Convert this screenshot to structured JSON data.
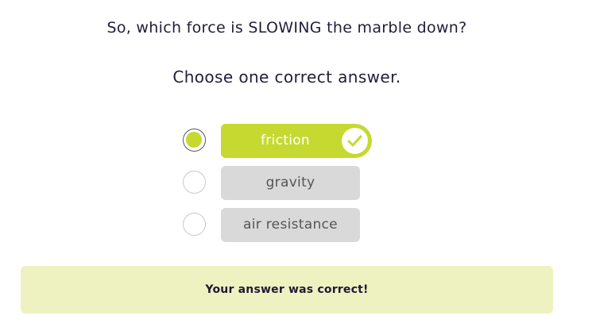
{
  "question": {
    "text": "So, which force is SLOWING the marble down?",
    "instruction": "Choose one correct answer."
  },
  "options": [
    {
      "label": "friction",
      "selected": true,
      "state": "correct",
      "icon": "check-icon"
    },
    {
      "label": "gravity",
      "selected": false,
      "state": "neutral"
    },
    {
      "label": "air resistance",
      "selected": false,
      "state": "neutral"
    }
  ],
  "feedback": {
    "text": "Your answer was correct!"
  },
  "colors": {
    "accent": "#c5d930",
    "feedback_bg": "#eef2c1",
    "option_bg": "#d9d9d9",
    "text_dark": "#241c3a"
  }
}
